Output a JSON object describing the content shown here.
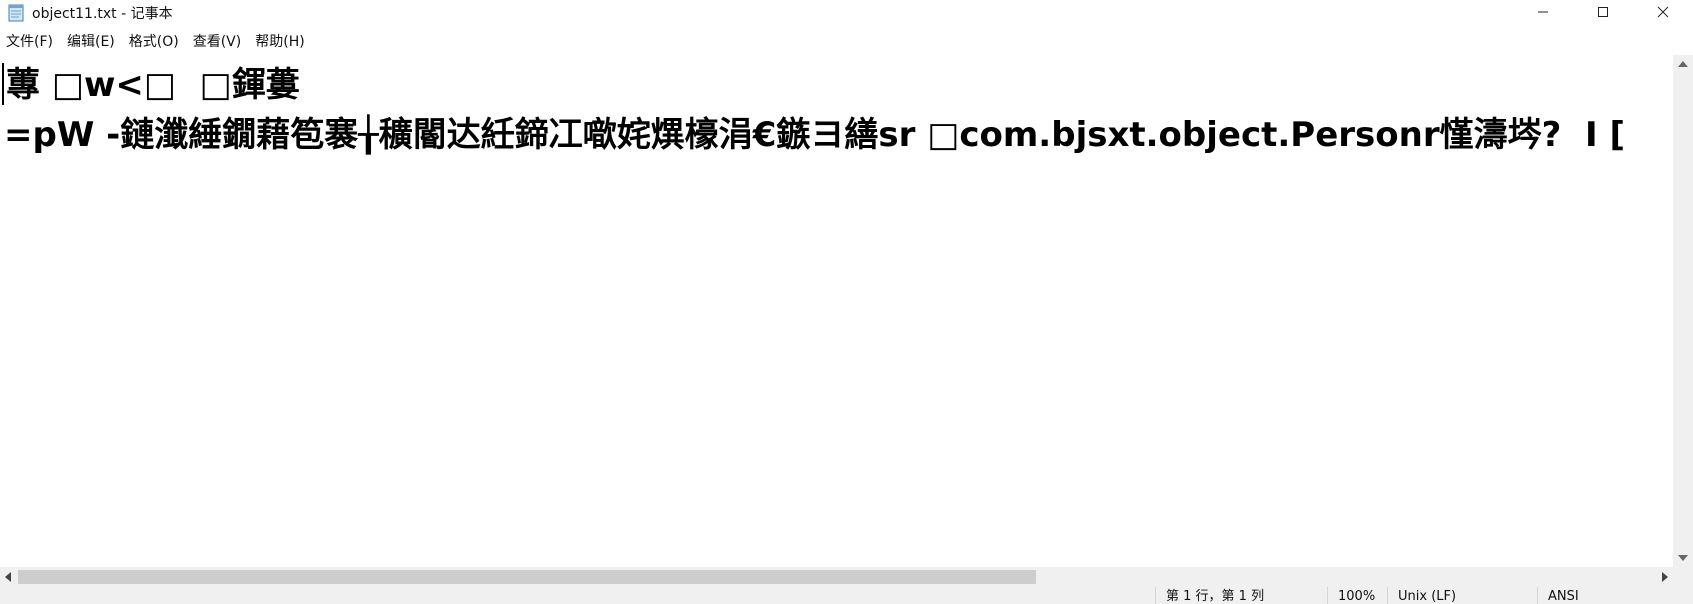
{
  "window": {
    "title": "object11.txt - 记事本",
    "icon": "notepad-icon"
  },
  "controls": {
    "minimize_icon": "minimize-icon",
    "maximize_icon": "maximize-icon",
    "close_icon": "close-icon"
  },
  "menu": {
    "items": [
      {
        "label": "文件(F)"
      },
      {
        "label": "编辑(E)"
      },
      {
        "label": "格式(O)"
      },
      {
        "label": "查看(V)"
      },
      {
        "label": "帮助(H)"
      }
    ]
  },
  "editor": {
    "lines": [
      "蓴 □w<□  □鍕蔞",
      "=pW -鏈瀸綞鐗藉笣褰╁穬閽达紝鍗冮噷姹熼檺涓€鏃ヨ繕sr □com.bjsxt.object.Personr慬濤埁?  I ["
    ]
  },
  "status": {
    "position": "第 1 行，第 1 列",
    "zoom": "100%",
    "line_ending": "Unix (LF)",
    "encoding": "ANSI"
  },
  "colors": {
    "background": "#ffffff",
    "chrome": "#f0f0f0",
    "scroll_thumb": "#cdcdcd",
    "text": "#000000"
  }
}
